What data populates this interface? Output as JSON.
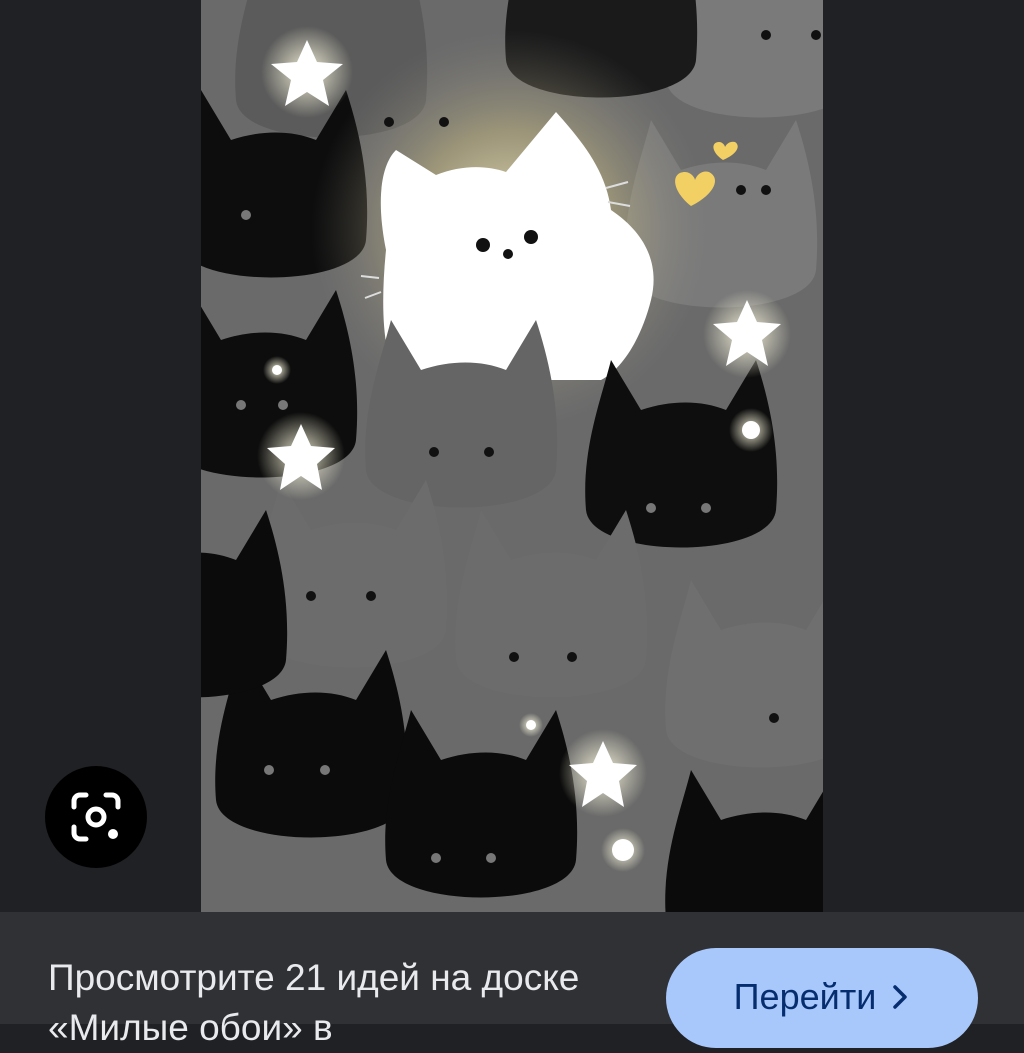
{
  "viewer": {
    "image_alt": "Cute cat wallpaper",
    "lens_icon": "google-lens-icon"
  },
  "result": {
    "caption": "Просмотрите 21 идей на доске «Милые обои» в",
    "button_label": "Перейти",
    "button_icon": "chevron-right-icon"
  },
  "colors": {
    "page_bg": "#202124",
    "bar_bg": "#303134",
    "button_bg": "#a8c7fa",
    "button_text": "#062e6f",
    "caption_text": "#e8eaed",
    "glow": "#f5f0c8",
    "heart": "#f2d064"
  }
}
